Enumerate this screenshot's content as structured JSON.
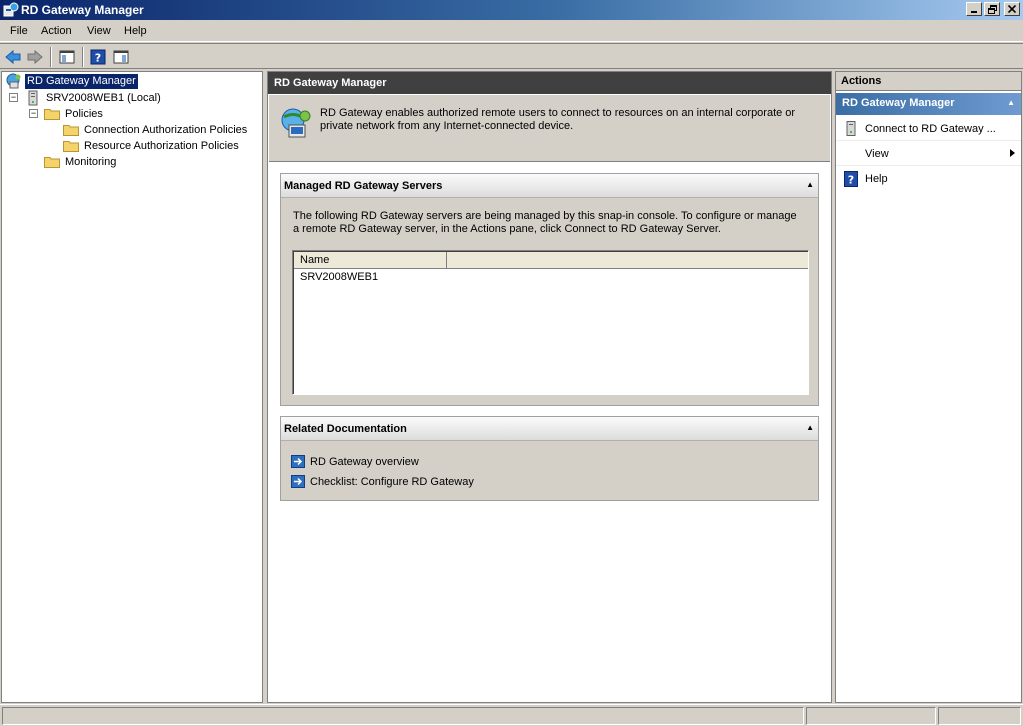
{
  "window": {
    "title": "RD Gateway Manager"
  },
  "menu": [
    "File",
    "Action",
    "View",
    "Help"
  ],
  "tree": {
    "root": "RD Gateway Manager",
    "server": "SRV2008WEB1 (Local)",
    "policies": "Policies",
    "cap": "Connection Authorization Policies",
    "rap": "Resource Authorization Policies",
    "monitoring": "Monitoring"
  },
  "center": {
    "header": "RD Gateway Manager",
    "intro": "RD Gateway enables authorized remote users to connect to resources on an internal corporate or private network from any Internet-connected device.",
    "managed": {
      "title": "Managed RD Gateway Servers",
      "description": "The following RD Gateway servers are being managed by this snap-in console. To configure or manage a remote RD Gateway server, in the Actions pane, click Connect to RD Gateway Server.",
      "columns": [
        "Name",
        ""
      ],
      "rows": [
        "SRV2008WEB1"
      ]
    },
    "docs": {
      "title": "Related Documentation",
      "links": [
        "RD Gateway overview",
        "Checklist: Configure RD Gateway"
      ]
    }
  },
  "actions": {
    "header": "Actions",
    "section": "RD Gateway Manager",
    "items": [
      "Connect to RD Gateway ...",
      "View",
      "Help"
    ]
  },
  "colors": {
    "selection": "#0a246a",
    "titlebar": "#0a246a",
    "actions_section": "#3a6ea5"
  }
}
